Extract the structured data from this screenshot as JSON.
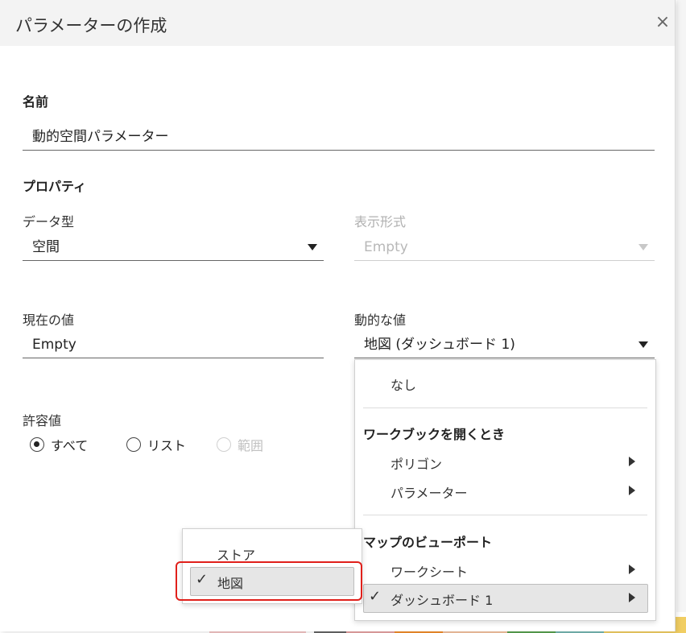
{
  "dialog": {
    "title": "パラメーターの作成",
    "close_symbol": "×"
  },
  "name_section": {
    "label": "名前",
    "value": "動的空間パラメーター"
  },
  "properties": {
    "label": "プロパティ",
    "data_type": {
      "label": "データ型",
      "value": "空間"
    },
    "display_format": {
      "label": "表示形式",
      "value": "Empty"
    },
    "current_value": {
      "label": "現在の値",
      "value": "Empty"
    },
    "dynamic_value": {
      "label": "動的な値",
      "value": "地図 (ダッシュボード 1)"
    }
  },
  "allowable_values": {
    "label": "許容値",
    "options": [
      "すべて",
      "リスト",
      "範囲"
    ],
    "selected": "すべて"
  },
  "dynamic_menu": {
    "none_item": "なし",
    "section_workbook_open": "ワークブックを開くとき",
    "polygon": "ポリゴン",
    "parameter": "パラメーター",
    "section_map_viewport": "マップのビューポート",
    "worksheet": "ワークシート",
    "dashboard": "ダッシュボード 1"
  },
  "submenu": {
    "store": "ストア",
    "map": "地図"
  },
  "icons": {
    "close": "close-icon",
    "check": "check-icon",
    "dropdown": "chevron-down-icon",
    "submenu": "chevron-right-icon"
  },
  "colors": {
    "highlight_border": "#e0201b",
    "titlebar_bg": "#f3f3f3"
  }
}
